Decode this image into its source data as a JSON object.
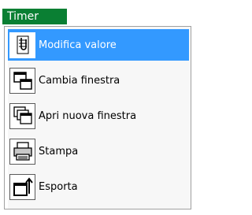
{
  "tab": {
    "label": "Timer"
  },
  "menu": {
    "items": [
      {
        "label": "Modifica valore",
        "icon": "paperclip-icon",
        "selected": true
      },
      {
        "label": "Cambia finestra",
        "icon": "window-switch-icon",
        "selected": false
      },
      {
        "label": "Apri nuova finestra",
        "icon": "new-window-icon",
        "selected": false
      },
      {
        "label": "Stampa",
        "icon": "printer-icon",
        "selected": false
      },
      {
        "label": "Esporta",
        "icon": "export-icon",
        "selected": false
      }
    ]
  },
  "colors": {
    "tab_bg": "#0a7f33",
    "selected_bg": "#3399ff"
  }
}
